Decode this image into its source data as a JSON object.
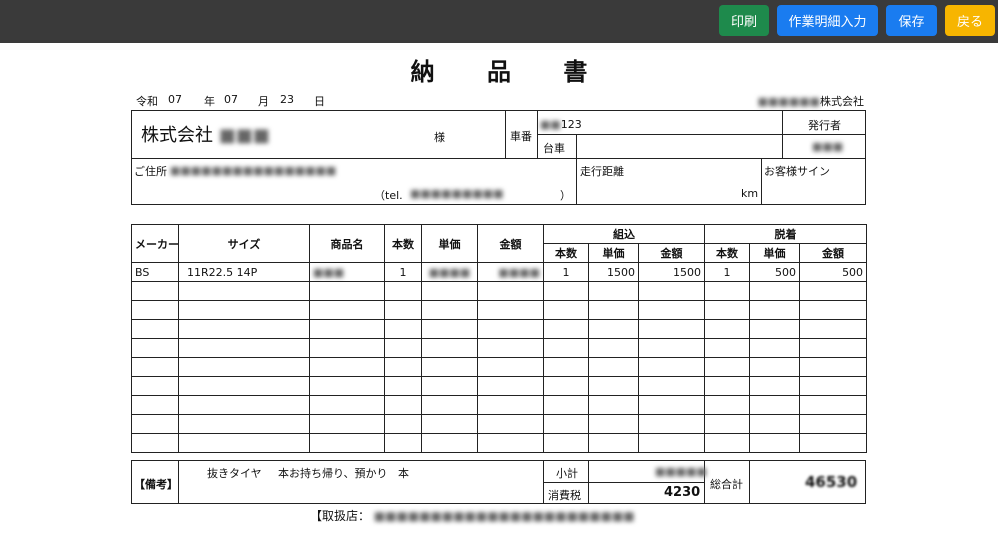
{
  "toolbar": {
    "print_label": "印刷",
    "detail_label": "作業明細入力",
    "save_label": "保存",
    "back_label": "戻る",
    "colors": {
      "print": "#1e8a4c",
      "detail": "#1a7cf0",
      "save": "#1a7cf0",
      "back": "#f7b500"
    }
  },
  "document": {
    "title": "納 品 書",
    "date": {
      "era": "令和",
      "year": "07",
      "year_unit": "年",
      "month": "07",
      "month_unit": "月",
      "day": "23",
      "day_unit": "日"
    },
    "issuer_company_suffix": "株式会社",
    "customer": {
      "prefix": "株式会社",
      "honorific": "様"
    },
    "vehicle": {
      "number_label": "車番",
      "number_value": "123",
      "chassis_label": "台車"
    },
    "issuer_label": "発行者",
    "address_label": "ご住所",
    "tel_label": "（tel.",
    "tel_close": "）",
    "mileage_label": "走行距離",
    "mileage_unit": "km",
    "signature_label": "お客様サイン"
  },
  "table": {
    "headers": {
      "maker": "メーカー",
      "size": "サイズ",
      "product": "商品名",
      "qty": "本数",
      "unit_price": "単価",
      "amount": "金額",
      "assembly": "組込",
      "removal": "脱着",
      "sub_qty": "本数",
      "sub_unit_price": "単価",
      "sub_amount": "金額"
    },
    "rows": [
      {
        "maker": "BS",
        "size": "11R22.5 14P",
        "qty": "1",
        "asm_qty": "1",
        "asm_price": "1500",
        "asm_amount": "1500",
        "rem_qty": "1",
        "rem_price": "500",
        "rem_amount": "500"
      }
    ],
    "empty_rows": 9
  },
  "remarks": {
    "label": "【備考】",
    "text1": "抜きタイヤ",
    "text2": "本お持ち帰り、預かり",
    "text3": "本"
  },
  "totals": {
    "subtotal_label": "小計",
    "tax_label": "消費税",
    "tax_value": "4230",
    "grand_total_label": "総合計",
    "grand_total_value": "46530"
  },
  "footer": {
    "store_label": "【取扱店："
  }
}
